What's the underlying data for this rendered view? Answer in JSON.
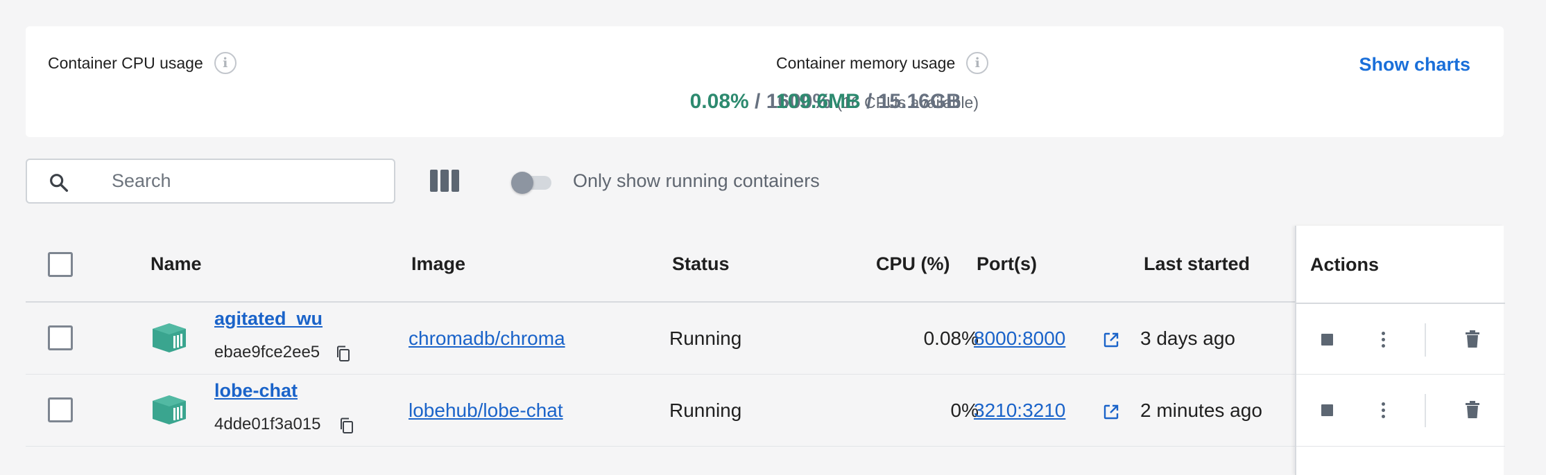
{
  "usage": {
    "cpu": {
      "title": "Container CPU usage",
      "used": "0.08%",
      "separator": " / ",
      "total": "1600%",
      "available": "(16 CPUs available)"
    },
    "memory": {
      "title": "Container memory usage",
      "used": "109.6MB",
      "separator": " / ",
      "total": "15.16GB"
    },
    "show_charts_label": "Show charts"
  },
  "toolbar": {
    "search_placeholder": "Search",
    "toggle_label": "Only show running containers",
    "toggle_on": false
  },
  "table": {
    "headers": {
      "name": "Name",
      "image": "Image",
      "status": "Status",
      "cpu": "CPU (%)",
      "ports": "Port(s)",
      "last_started": "Last started",
      "actions": "Actions"
    },
    "rows": [
      {
        "name": "agitated_wu",
        "id": "ebae9fce2ee5",
        "image": "chromadb/chroma",
        "status": "Running",
        "cpu": "0.08%",
        "port": "8000:8000",
        "last_started": "3 days ago"
      },
      {
        "name": "lobe-chat",
        "id": "4dde01f3a015",
        "image": "lobehub/lobe-chat",
        "status": "Running",
        "cpu": "0%",
        "port": "3210:3210",
        "last_started": "2 minutes ago"
      }
    ]
  },
  "colors": {
    "accent_link": "#1a63c9",
    "usage_green": "#2d8a6f",
    "container_icon": "#3aa58f"
  },
  "icons": {
    "search": "search-icon",
    "info": "info-icon",
    "columns": "columns-icon",
    "container": "container-icon",
    "copy": "copy-icon",
    "external_link": "external-link-icon",
    "stop": "stop-icon",
    "more": "more-vertical-icon",
    "delete": "trash-icon"
  }
}
